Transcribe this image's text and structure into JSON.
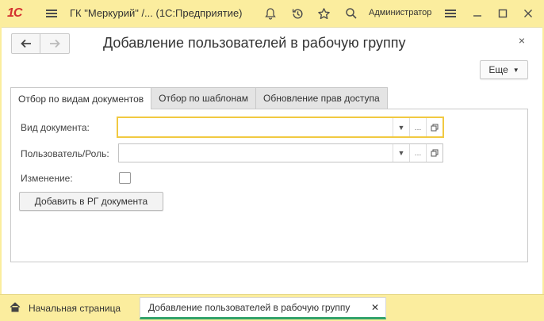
{
  "titlebar": {
    "logo": "1С",
    "title": "ГК \"Меркурий\" /...  (1С:Предприятие)",
    "user": "Администратор",
    "icons": [
      "menu-icon",
      "bell-icon",
      "history-icon",
      "star-icon",
      "search-icon",
      "settings-icon",
      "minimize-icon",
      "maximize-icon",
      "close-icon"
    ]
  },
  "window": {
    "title": "Добавление пользователей в рабочую группу",
    "more_label": "Еще",
    "close_glyph": "×"
  },
  "tabs": [
    {
      "label": "Отбор по видам документов",
      "active": true
    },
    {
      "label": "Отбор по шаблонам",
      "active": false
    },
    {
      "label": "Обновление прав доступа",
      "active": false
    }
  ],
  "form": {
    "doc_type_label": "Вид документа:",
    "doc_type_value": "",
    "user_role_label": "Пользователь/Роль:",
    "user_role_value": "",
    "change_label": "Изменение:",
    "change_checked": false,
    "add_button_label": "Добавить в РГ документа"
  },
  "taskbar": {
    "home_label": "Начальная страница",
    "doc_label": "Добавление пользователей в рабочую группу",
    "accent_color": "#31a26a"
  }
}
